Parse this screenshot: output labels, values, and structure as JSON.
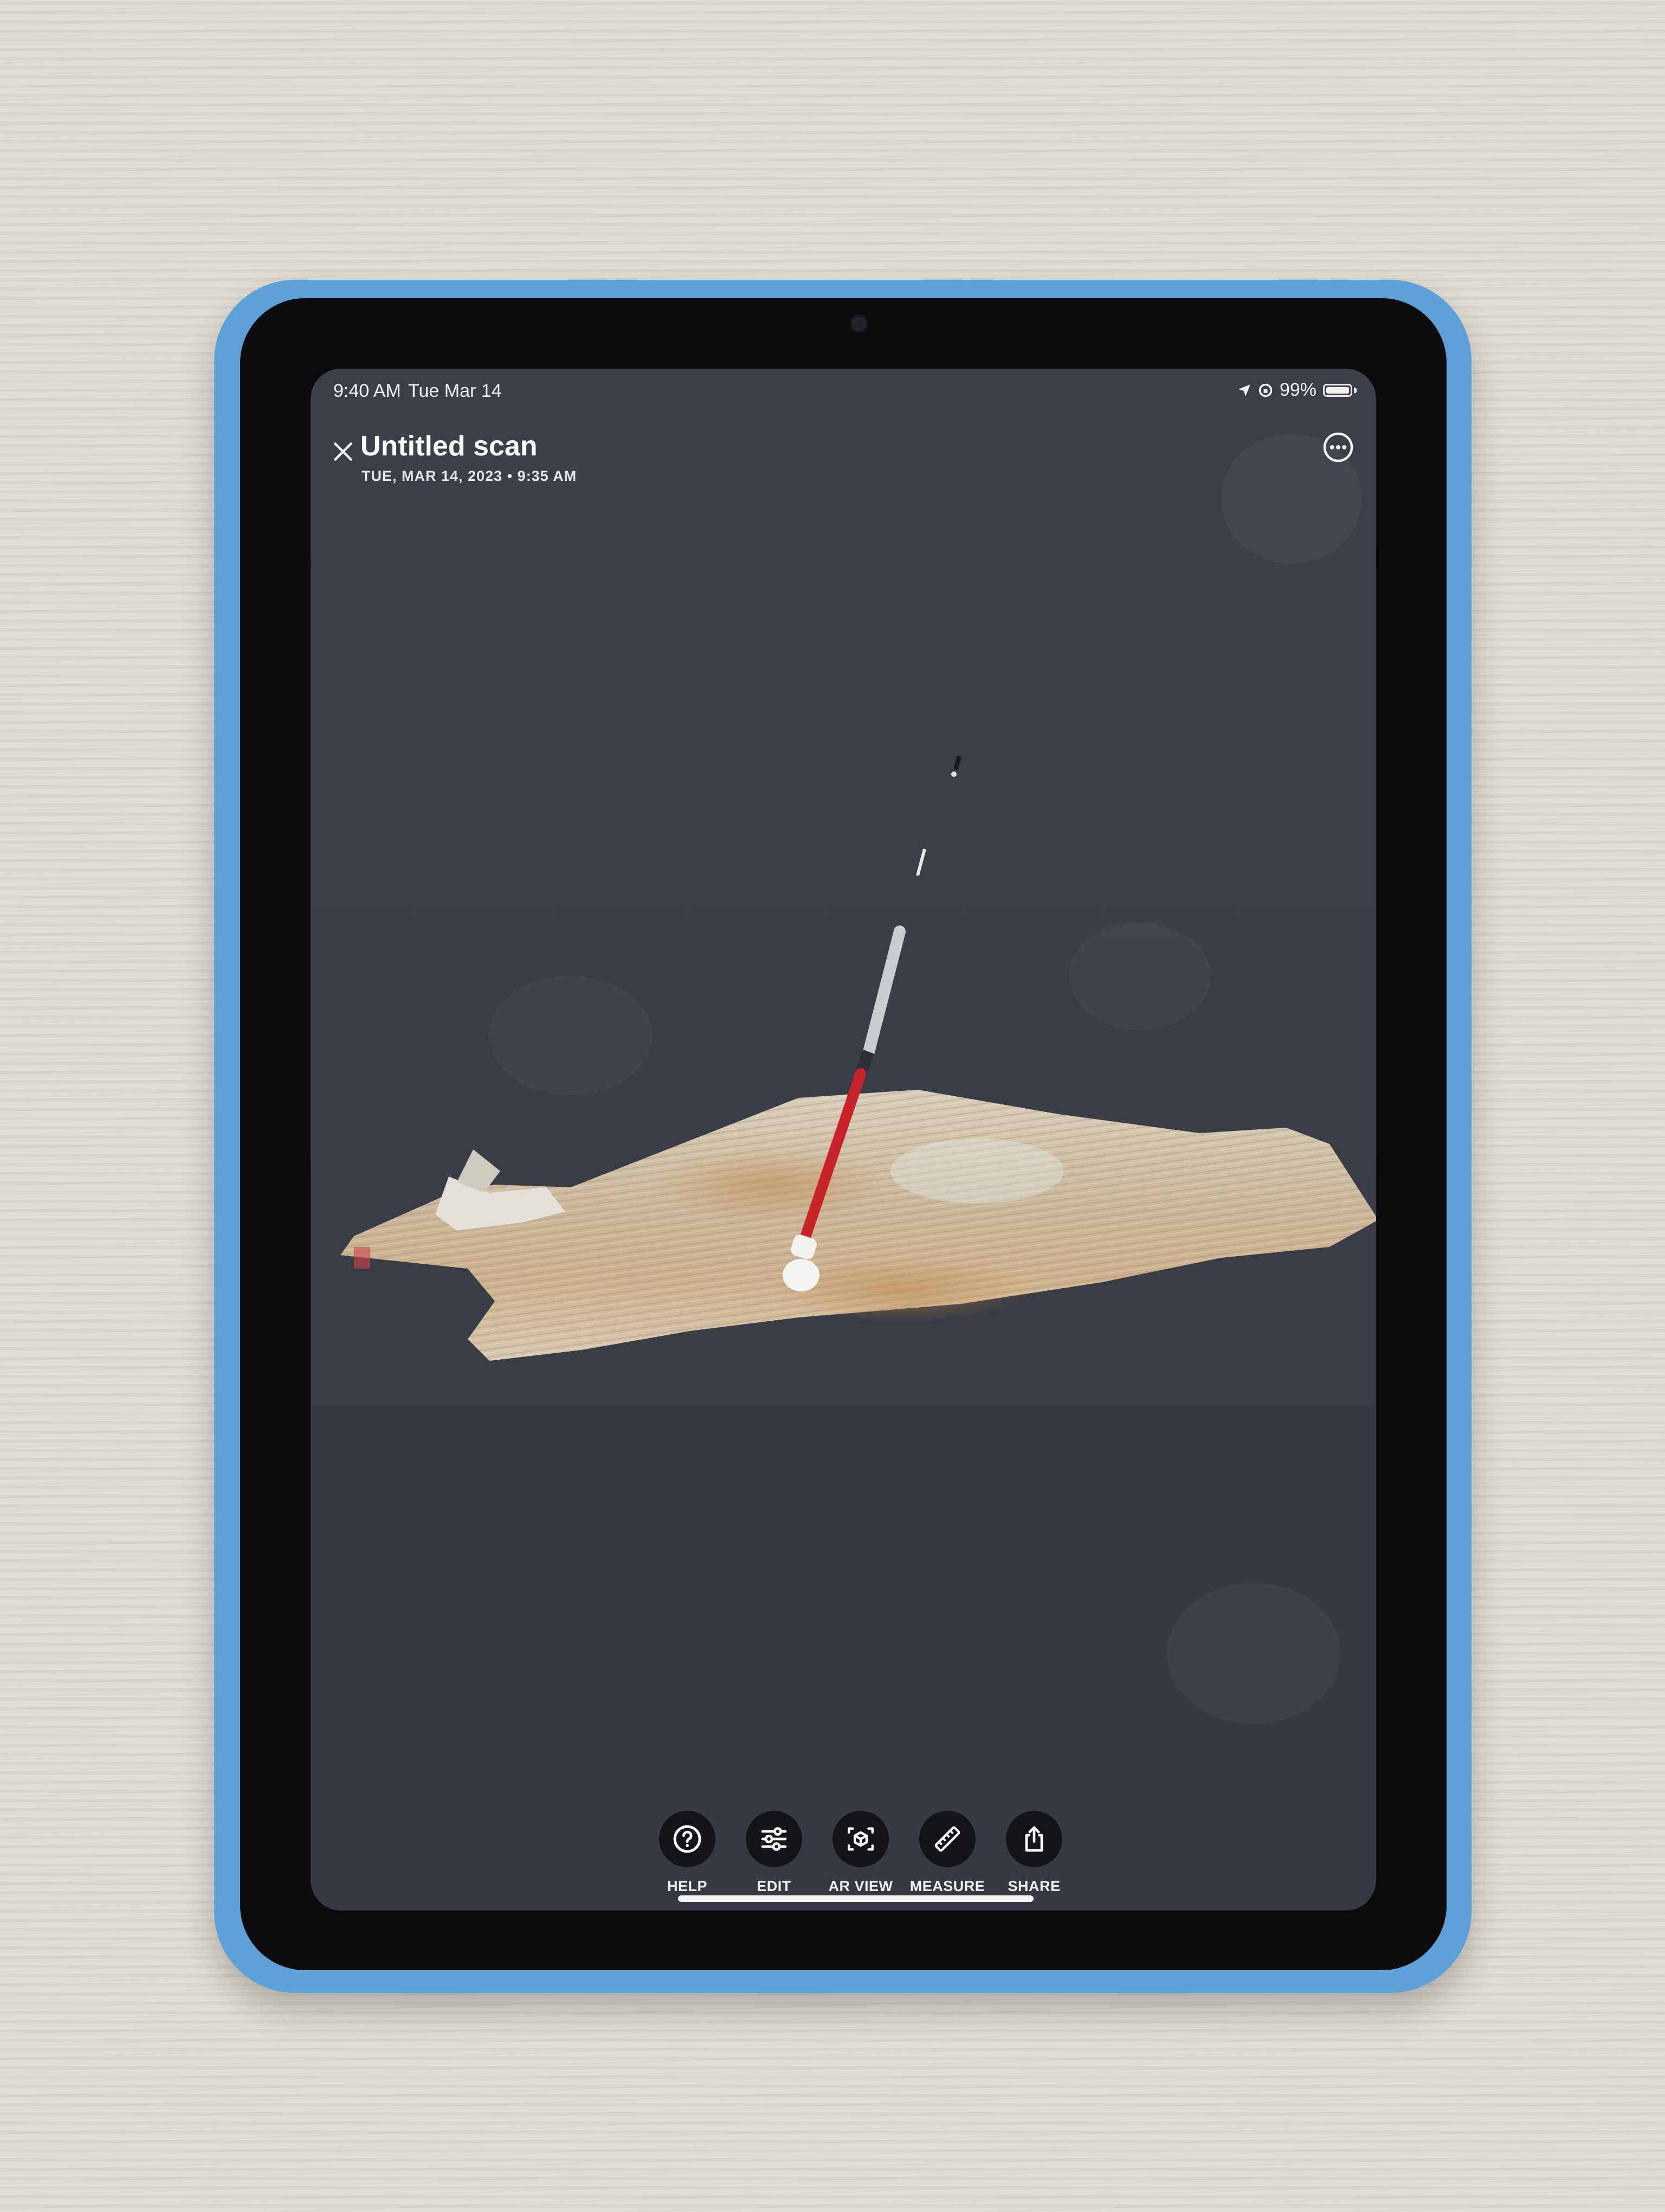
{
  "statusbar": {
    "time": "9:40 AM",
    "date": "Tue Mar 14",
    "battery": "99%",
    "battery_level": 0.99,
    "icons": [
      "location-arrow-icon",
      "screen-lock-rotation-icon",
      "battery-icon"
    ]
  },
  "header": {
    "title": "Untitled scan",
    "subtitle": "TUE, MAR 14, 2023  •  9:35 AM",
    "close_icon": "close-icon",
    "more_icon": "more-options-icon"
  },
  "scene": {
    "description_icon": "3d-scan-model"
  },
  "toolbar": {
    "items": [
      {
        "label": "HELP",
        "icon": "help-icon"
      },
      {
        "label": "EDIT",
        "icon": "sliders-icon"
      },
      {
        "label": "AR VIEW",
        "icon": "ar-cube-icon"
      },
      {
        "label": "MEASURE",
        "icon": "ruler-icon"
      },
      {
        "label": "SHARE",
        "icon": "share-icon"
      }
    ]
  },
  "colors": {
    "case": "#5da1d6",
    "screen_bg": "#3a3d46",
    "toolbar_button": "#141518",
    "cane_red": "#c8232a"
  }
}
